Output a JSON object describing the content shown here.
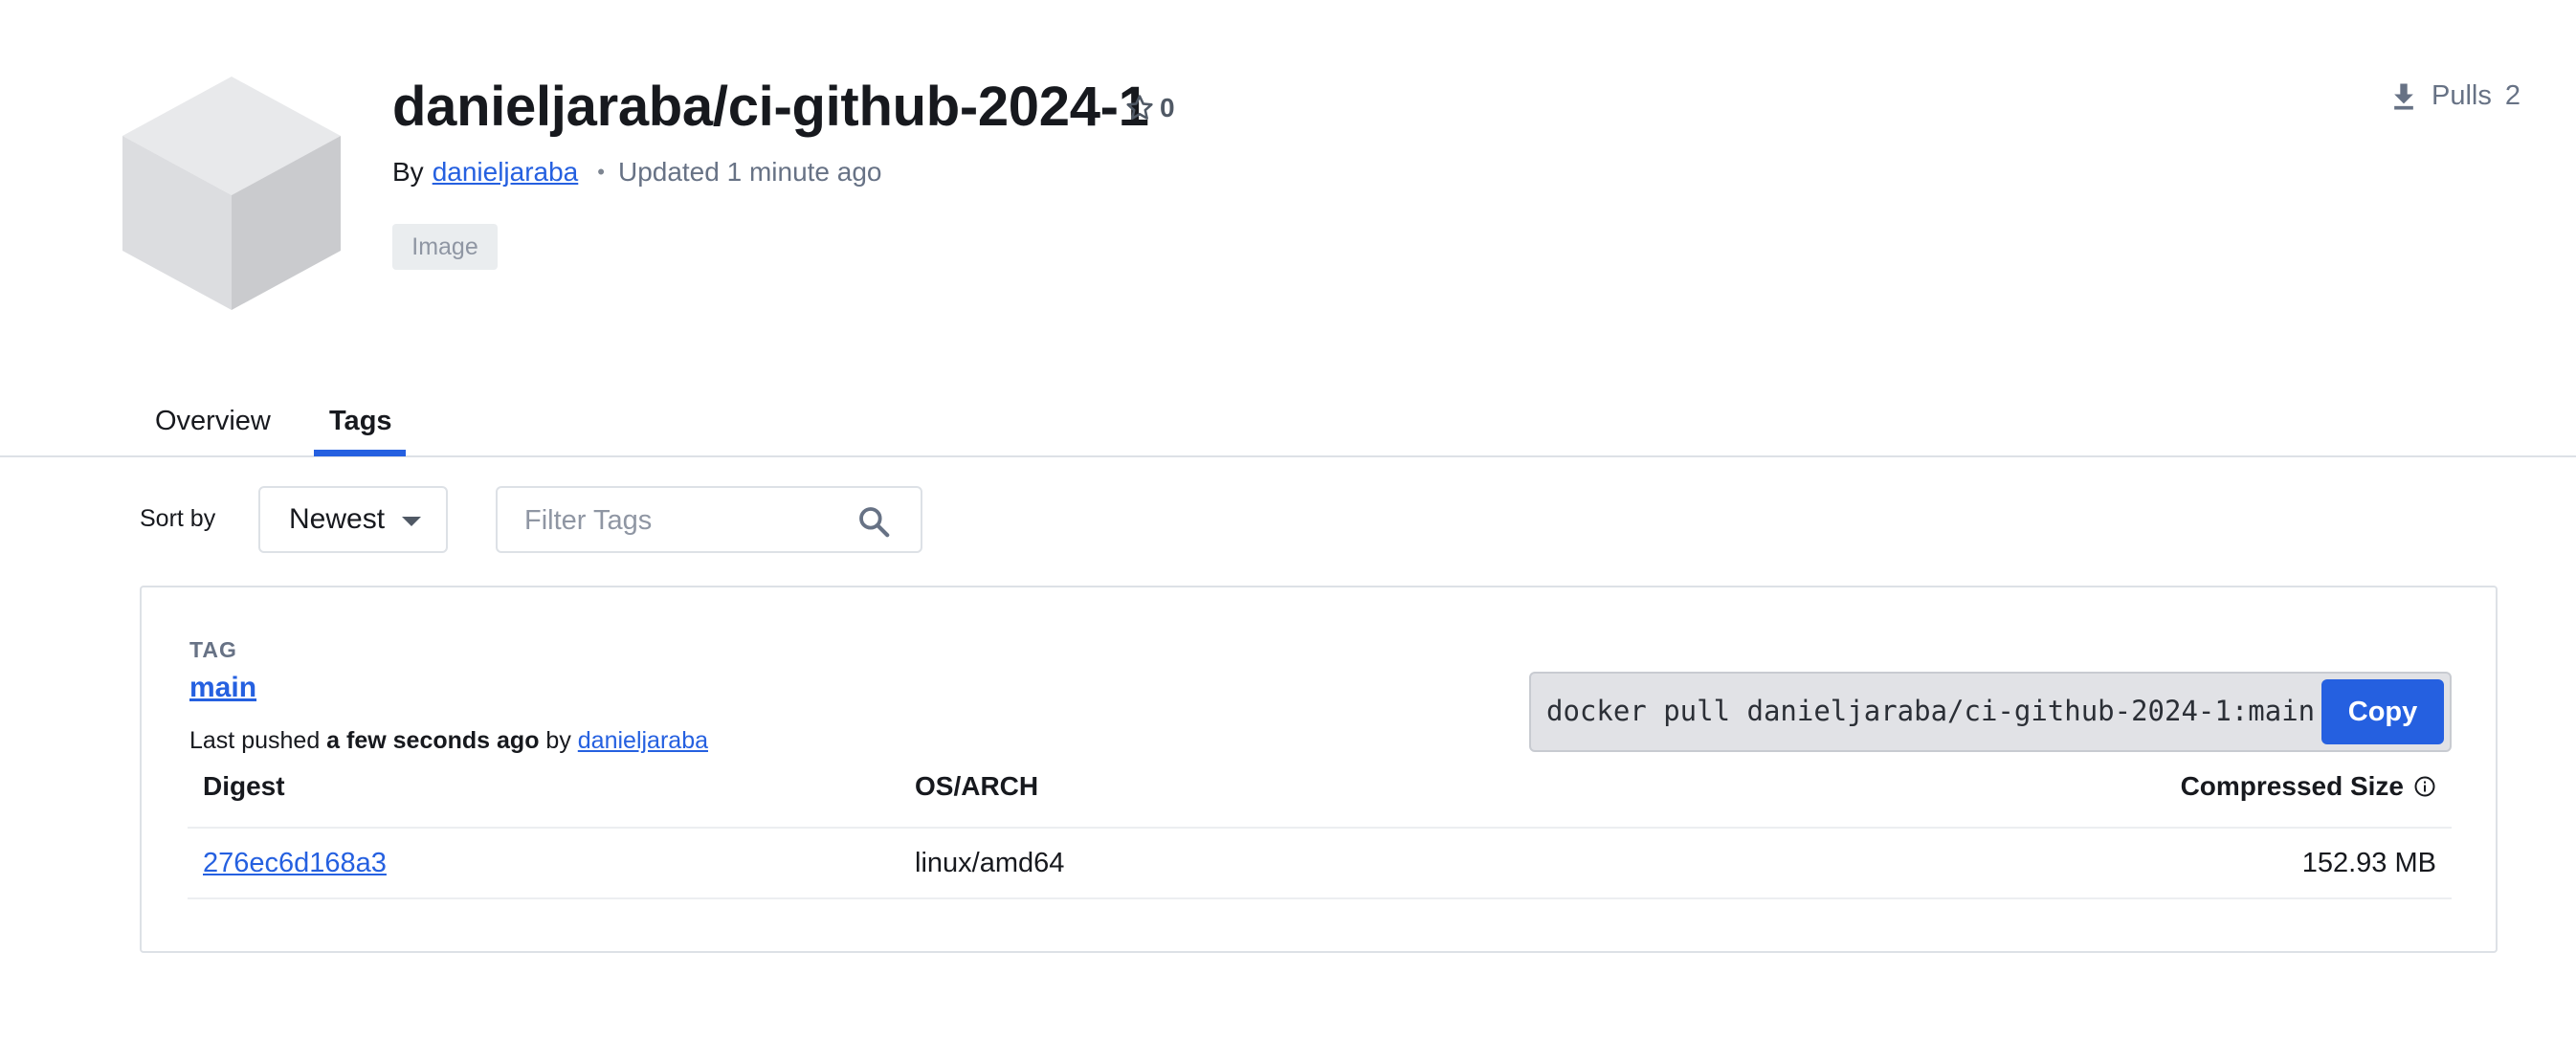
{
  "repo": {
    "title": "danieljaraba/ci-github-2024-1",
    "stars": "0",
    "by_label": "By",
    "owner": "danieljaraba",
    "updated": "Updated 1 minute ago",
    "badge": "Image",
    "pulls_label": "Pulls",
    "pulls_count": "2"
  },
  "tabs": [
    {
      "label": "Overview",
      "active": false
    },
    {
      "label": "Tags",
      "active": true
    }
  ],
  "controls": {
    "sort_label": "Sort by",
    "sort_value": "Newest",
    "filter_placeholder": "Filter Tags"
  },
  "tag_card": {
    "heading": "TAG",
    "tag_name": "main",
    "last_pushed_prefix": "Last pushed",
    "last_pushed_when": "a few seconds ago",
    "by": "by",
    "pushed_by": "danieljaraba",
    "pull_command": "docker pull danieljaraba/ci-github-2024-1:main",
    "copy_label": "Copy",
    "table": {
      "headers": {
        "digest": "Digest",
        "os_arch": "OS/ARCH",
        "size": "Compressed Size"
      },
      "rows": [
        {
          "digest": "276ec6d168a3",
          "os_arch": "linux/amd64",
          "size": "152.93 MB"
        }
      ]
    }
  },
  "colors": {
    "accent": "#2560e0",
    "muted_text": "#677285",
    "border": "#dde1e6"
  }
}
